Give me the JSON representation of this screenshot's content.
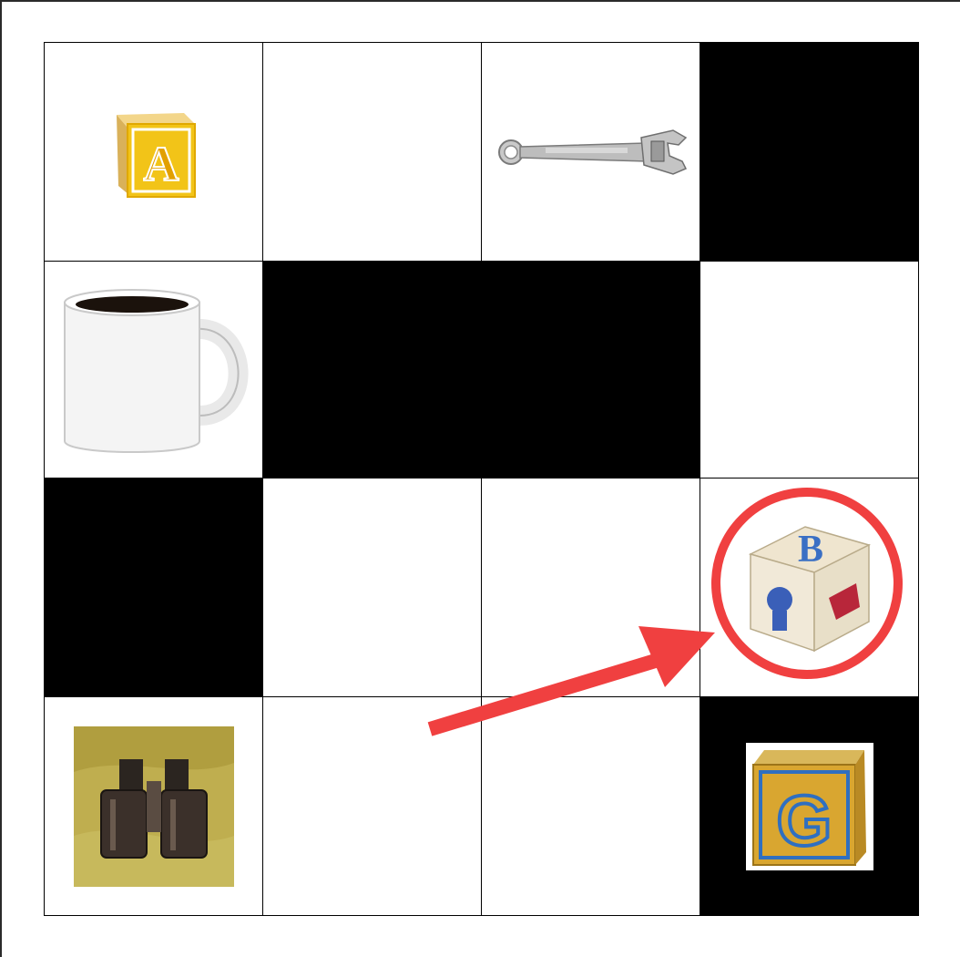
{
  "board": {
    "rows": 4,
    "cols": 4,
    "cells": [
      {
        "row": 0,
        "col": 0,
        "type": "open",
        "item": "letter-block-a-icon"
      },
      {
        "row": 0,
        "col": 1,
        "type": "open",
        "item": null
      },
      {
        "row": 0,
        "col": 2,
        "type": "open",
        "item": "wrench-icon"
      },
      {
        "row": 0,
        "col": 3,
        "type": "wall",
        "item": null
      },
      {
        "row": 1,
        "col": 0,
        "type": "open",
        "item": "coffee-mug-icon"
      },
      {
        "row": 1,
        "col": 1,
        "type": "wall",
        "item": null
      },
      {
        "row": 1,
        "col": 2,
        "type": "wall",
        "item": null
      },
      {
        "row": 1,
        "col": 3,
        "type": "open",
        "item": null
      },
      {
        "row": 2,
        "col": 0,
        "type": "wall",
        "item": null
      },
      {
        "row": 2,
        "col": 1,
        "type": "open",
        "item": null
      },
      {
        "row": 2,
        "col": 2,
        "type": "open",
        "item": null
      },
      {
        "row": 2,
        "col": 3,
        "type": "open",
        "item": "letter-block-b-icon"
      },
      {
        "row": 3,
        "col": 0,
        "type": "open",
        "item": "binoculars-icon"
      },
      {
        "row": 3,
        "col": 1,
        "type": "open",
        "item": null
      },
      {
        "row": 3,
        "col": 2,
        "type": "open",
        "item": null
      },
      {
        "row": 3,
        "col": 3,
        "type": "wall",
        "item": "letter-block-g-icon"
      }
    ]
  },
  "blocks": {
    "a": {
      "letter": "A"
    },
    "b": {
      "letter": "B"
    },
    "g": {
      "letter": "G"
    }
  },
  "annotation": {
    "target_circle": {
      "row": 2,
      "col": 3
    },
    "arrow_color": "#f04040",
    "circle_color": "#f04040"
  },
  "colors": {
    "wall": "#000000",
    "open": "#ffffff",
    "grid_line": "#000000"
  }
}
